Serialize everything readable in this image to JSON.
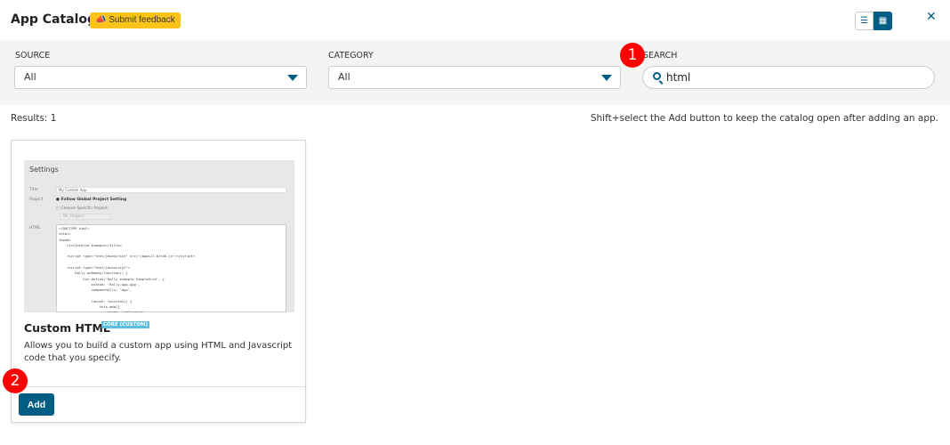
{
  "header": {
    "title": "App Catalog",
    "feedback_label": "Submit feedback",
    "feedback_icon": "megaphone-icon",
    "list_view_icon": "list-icon",
    "grid_view_icon": "grid-icon",
    "close_icon": "close-icon"
  },
  "filters": {
    "source": {
      "label": "SOURCE",
      "value": "All"
    },
    "category": {
      "label": "CATEGORY",
      "value": "All"
    },
    "search": {
      "label": "SEARCH",
      "value": "html"
    }
  },
  "results": {
    "count_text": "Results: 1",
    "hint": "Shift+select the Add button to keep the catalog open after adding an app."
  },
  "card": {
    "title": "Custom HTML",
    "badge": "CORE (CUSTOM)",
    "description": "Allows you to build a custom app using HTML and Javascript code that you specify.",
    "add_label": "Add",
    "thumbnail": {
      "heading": "Settings",
      "title_label": "Title",
      "title_value": "My Custom App",
      "project_label": "Project",
      "option1": "Follow Global Project Setting",
      "option2": "Choose Specific Project",
      "project_select": "Mr. Rogers",
      "html_label": "HTML",
      "code": "<!DOCTYPE html>\n<html>\n<head>\n    <title>Grid Example</title>\n\n    <script type=\"text/javascript\" src=\"/apps/2.0/sdk.js\"></script>\n\n    <script type=\"text/javascript\">\n        Rally.onReady(function() {\n            Ext.define('Rally.example.SimpleGrid', {\n                extend: 'Rally.app.App',\n                componentCls: 'app',\n\n                launch: function() {\n                    this.add({\n                        xtype: 'rallygrid',"
    }
  },
  "markers": [
    "1",
    "2"
  ],
  "colors": {
    "accent": "#005e85",
    "feedback": "#fcc419",
    "badge": "#5bc0de",
    "marker": "#ff0000"
  }
}
